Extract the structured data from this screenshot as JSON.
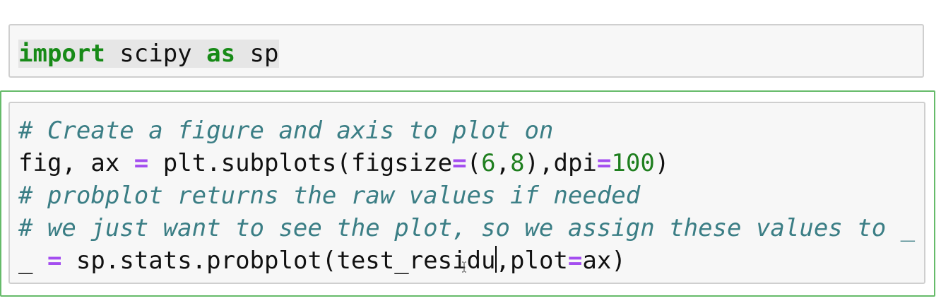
{
  "cells": [
    {
      "lines": [
        {
          "tokens": [
            {
              "text": "import",
              "cls": "kw hl"
            },
            {
              "text": " scipy ",
              "cls": "hl"
            },
            {
              "text": "as",
              "cls": "kw hl"
            },
            {
              "text": " sp",
              "cls": "hl"
            }
          ]
        }
      ],
      "selected": false
    },
    {
      "lines": [
        {
          "tokens": [
            {
              "text": "# Create a figure and axis to plot on",
              "cls": "cm"
            }
          ]
        },
        {
          "tokens": [
            {
              "text": "fig, ax ",
              "cls": ""
            },
            {
              "text": "=",
              "cls": "op"
            },
            {
              "text": " plt.subplots(figsize",
              "cls": ""
            },
            {
              "text": "=",
              "cls": "op"
            },
            {
              "text": "(",
              "cls": ""
            },
            {
              "text": "6",
              "cls": "num"
            },
            {
              "text": ",",
              "cls": ""
            },
            {
              "text": "8",
              "cls": "num"
            },
            {
              "text": "),dpi",
              "cls": ""
            },
            {
              "text": "=",
              "cls": "op"
            },
            {
              "text": "100",
              "cls": "num"
            },
            {
              "text": ")",
              "cls": ""
            }
          ]
        },
        {
          "tokens": [
            {
              "text": "# probplot returns the raw values if needed",
              "cls": "cm"
            }
          ]
        },
        {
          "tokens": [
            {
              "text": "# we just want to see the plot, so we assign these values to _",
              "cls": "cm"
            }
          ]
        },
        {
          "tokens": [
            {
              "text": "_ ",
              "cls": ""
            },
            {
              "text": "=",
              "cls": "op"
            },
            {
              "text": " sp.stats.probplot(test_residu",
              "cls": ""
            },
            {
              "text": "",
              "cls": "cursor"
            },
            {
              "text": ",plot",
              "cls": ""
            },
            {
              "text": "=",
              "cls": "op"
            },
            {
              "text": "ax)",
              "cls": ""
            }
          ]
        }
      ],
      "selected": true
    }
  ]
}
